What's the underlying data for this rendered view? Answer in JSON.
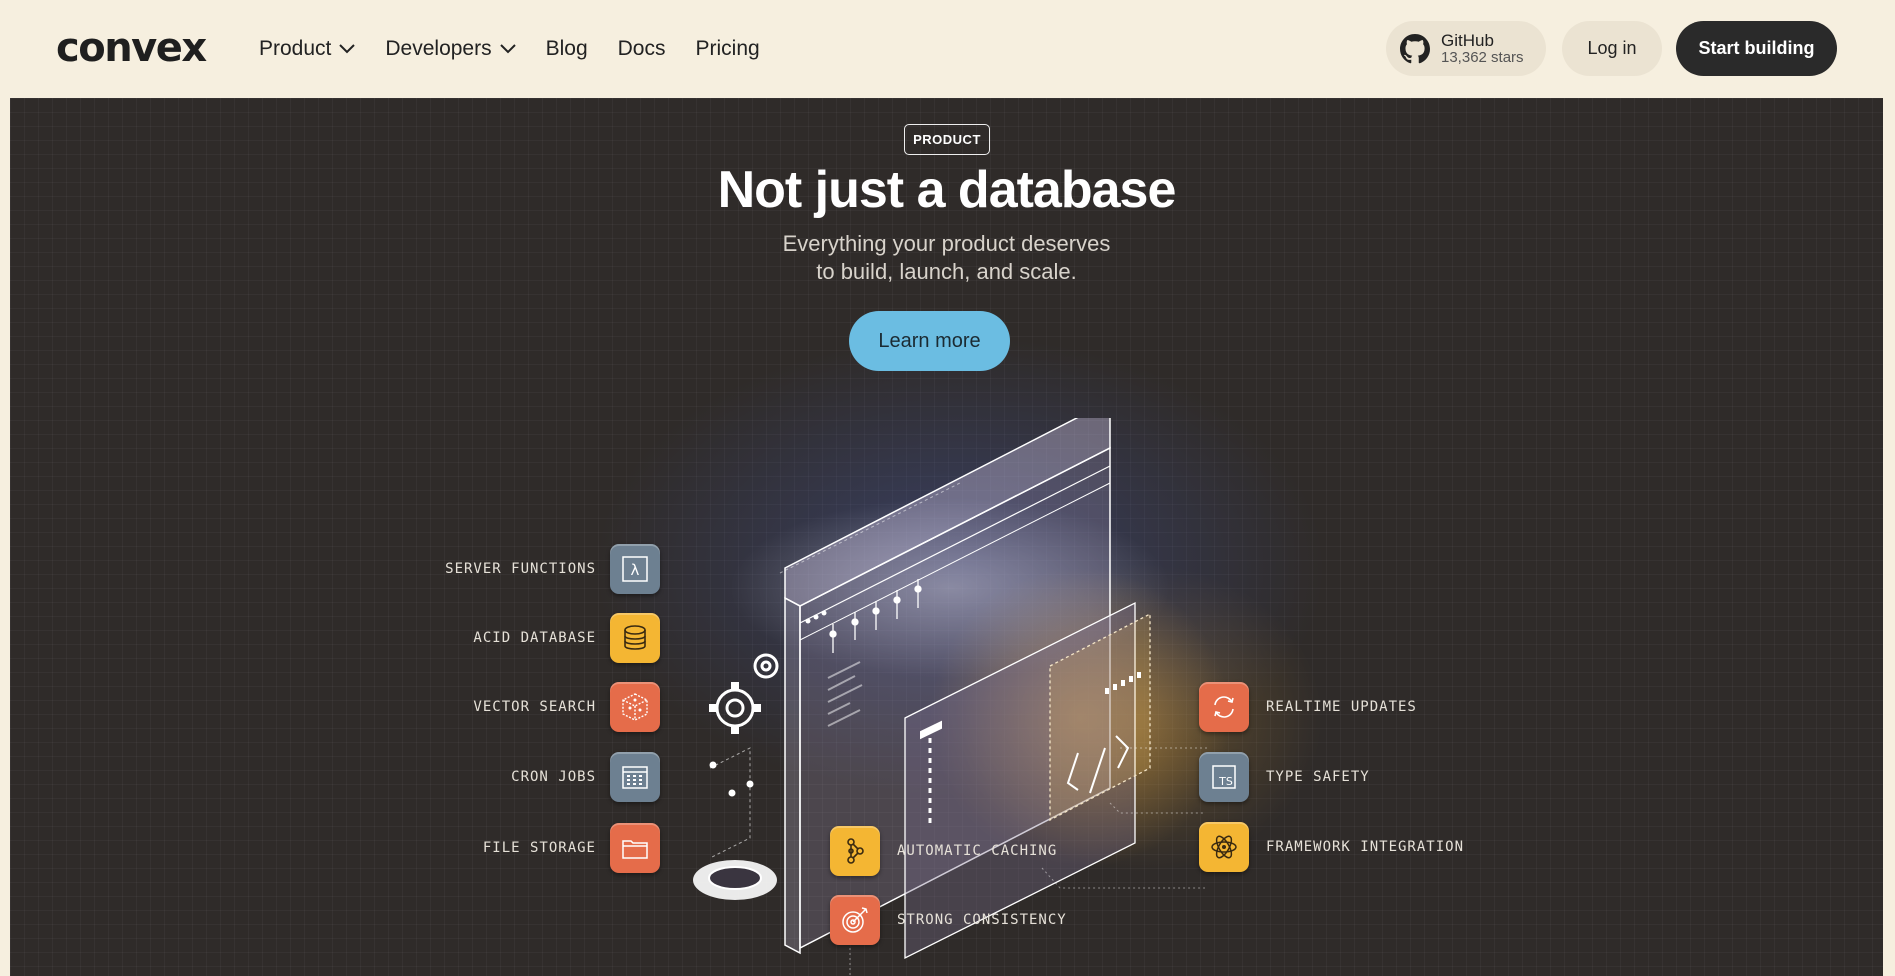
{
  "nav": {
    "logo": "convex",
    "links": [
      "Product",
      "Developers",
      "Blog",
      "Docs",
      "Pricing"
    ],
    "github": {
      "name": "GitHub",
      "stars": "13,362 stars"
    },
    "login": "Log in",
    "start": "Start building"
  },
  "hero": {
    "badge": "PRODUCT",
    "title": "Not just a database",
    "subtitle_line1": "Everything your product deserves",
    "subtitle_line2": "to build, launch, and scale.",
    "cta": "Learn more"
  },
  "features": {
    "left": [
      {
        "label": "SERVER FUNCTIONS",
        "icon": "lambda-icon",
        "color": "#6d8091"
      },
      {
        "label": "ACID DATABASE",
        "icon": "database-icon",
        "color": "#f4b633"
      },
      {
        "label": "VECTOR SEARCH",
        "icon": "vector-cube-icon",
        "color": "#e56c4a"
      },
      {
        "label": "CRON JOBS",
        "icon": "calendar-icon",
        "color": "#6d8091"
      },
      {
        "label": "FILE STORAGE",
        "icon": "folder-icon",
        "color": "#e56c4a"
      }
    ],
    "bottom": [
      {
        "label": "AUTOMATIC CACHING",
        "icon": "nodes-icon",
        "color": "#f4b633"
      },
      {
        "label": "STRONG CONSISTENCY",
        "icon": "target-icon",
        "color": "#e56c4a"
      }
    ],
    "right": [
      {
        "label": "REALTIME UPDATES",
        "icon": "refresh-icon",
        "color": "#e56c4a"
      },
      {
        "label": "TYPE SAFETY",
        "icon": "typescript-icon",
        "color": "#6d8091",
        "icon_text": "TS"
      },
      {
        "label": "FRAMEWORK INTEGRATION",
        "icon": "react-atom-icon",
        "color": "#f4b633"
      }
    ]
  }
}
